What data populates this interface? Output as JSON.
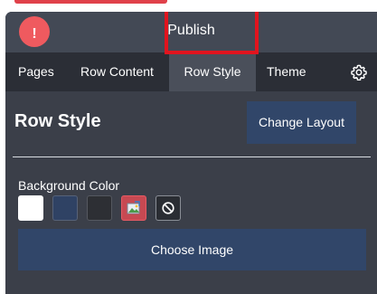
{
  "header": {
    "title": "Publish",
    "alert_icon_glyph": "!"
  },
  "tabs": [
    {
      "label": "Pages",
      "active": false
    },
    {
      "label": "Row Content",
      "active": false
    },
    {
      "label": "Row Style",
      "active": true
    },
    {
      "label": "Theme",
      "active": false
    }
  ],
  "settings_icon": "gear-icon",
  "section": {
    "title": "Row Style",
    "change_layout_label": "Change Layout"
  },
  "background": {
    "label": "Background Color",
    "swatches": [
      {
        "name": "white",
        "color": "#ffffff"
      },
      {
        "name": "navy",
        "color": "#2f4264"
      },
      {
        "name": "dark",
        "color": "#2d2f34"
      },
      {
        "name": "image",
        "icon": "image-icon",
        "selected": true
      },
      {
        "name": "none",
        "icon": "no-color-icon"
      }
    ],
    "choose_image_label": "Choose Image"
  },
  "colors": {
    "panel": "#3b3f49",
    "tabbar": "#2b2e36",
    "button": "#314669",
    "highlight": "#e1141e",
    "alert": "#ef5a5f"
  }
}
